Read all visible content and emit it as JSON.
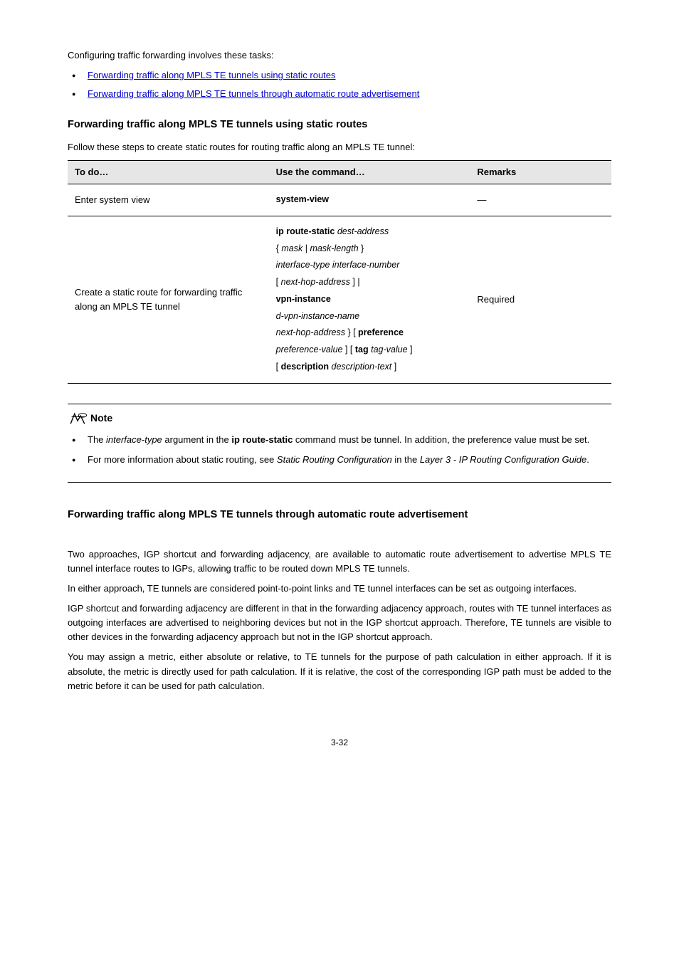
{
  "intro": {
    "lead": "Configuring traffic forwarding involves these tasks:",
    "bullets": [
      "Forwarding traffic along MPLS TE tunnels using static routes",
      "Forwarding traffic along MPLS TE tunnels through automatic route advertisement"
    ]
  },
  "section_static": {
    "heading": "Forwarding traffic along MPLS TE tunnels using static routes",
    "lead": "Follow these steps to create static routes for routing traffic along an MPLS TE tunnel:"
  },
  "table": {
    "headers": {
      "c1": "To do…",
      "c2": "Use the command…",
      "c3": "Remarks"
    },
    "rows": [
      {
        "c1": "Enter system view",
        "c2_bold": "system-view",
        "c3": "—"
      },
      {
        "c1": "Create a static route for forwarding traffic along an MPLS TE tunnel",
        "c2_parts": {
          "kw_iproute": "ip route-static",
          "it_dest": "dest-address",
          "sep_brace_open": "{",
          "it_mask": "mask",
          "sep_pipe": " | ",
          "it_masklen": "mask-length",
          "sep_brace_close": "}",
          "it_ifctype": "interface-type interface-number",
          "sep_brk_open": "[",
          "it_nexthop": "next-hop-address",
          "sep_brk_close": "] |",
          "kw_vpn": "vpn-instance",
          "it_dvpn": "d-vpn-instance-name",
          "it_nexthop2": "next-hop-address",
          "sep_close_brace": "} [",
          "kw_pref": "preference",
          "it_prefval": "preference-value",
          "sep_mid": "] [",
          "kw_tag": "tag",
          "it_tagval": "tag-value",
          "sep_mid2": "]",
          "sep_open2": "[",
          "kw_desc": "description",
          "it_desc": "description-text",
          "sep_close2": "]"
        },
        "c3": "Required"
      }
    ]
  },
  "note": {
    "label": "Note",
    "items": [
      {
        "pre": "The ",
        "arg": "interface-type",
        "mid": " argument in the ",
        "cmd": "ip route-static",
        "post": " command must be tunnel. In addition, the preference value must be set."
      },
      {
        "pre": "For more information about static routing, see ",
        "ital1": "Static Routing Configuration",
        "mid": " in the ",
        "ital2": "Layer 3 - IP Routing Configuration Guide",
        "post": "."
      }
    ]
  },
  "section_auto": {
    "heading": "Forwarding traffic along MPLS TE tunnels through automatic route advertisement",
    "p1": "Two approaches, IGP shortcut and forwarding adjacency, are available to automatic route advertisement to advertise MPLS TE tunnel interface routes to IGPs, allowing traffic to be routed down MPLS TE tunnels.",
    "p2": "In either approach, TE tunnels are considered point-to-point links and TE tunnel interfaces can be set as outgoing interfaces.",
    "p3": "IGP shortcut and forwarding adjacency are different in that in the forwarding adjacency approach, routes with TE tunnel interfaces as outgoing interfaces are advertised to neighboring devices but not in the IGP shortcut approach. Therefore, TE tunnels are visible to other devices in the forwarding adjacency approach but not in the IGP shortcut approach.",
    "p4": "You may assign a metric, either absolute or relative, to TE tunnels for the purpose of path calculation in either approach. If it is absolute, the metric is directly used for path calculation. If it is relative, the cost of the corresponding IGP path must be added to the metric before it can be used for path calculation."
  },
  "page_number": "3-32"
}
